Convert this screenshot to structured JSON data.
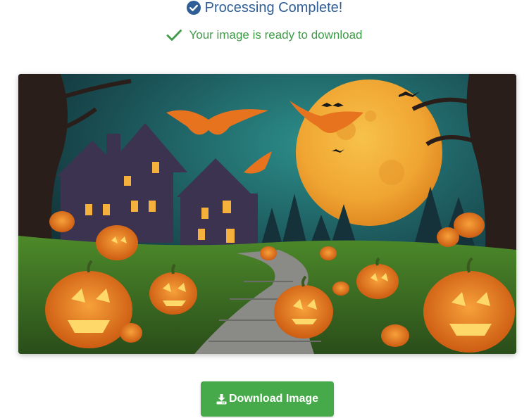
{
  "status": {
    "title": "Processing Complete!",
    "subtitle": "Your image is ready to download",
    "title_color": "#2f5e96",
    "success_color": "#3e9b47"
  },
  "result_image": {
    "description_icon": "image-preview",
    "scene": "halloween"
  },
  "actions": {
    "download_label": "Download Image",
    "download_icon": "download-icon",
    "button_color": "#46a94a"
  }
}
